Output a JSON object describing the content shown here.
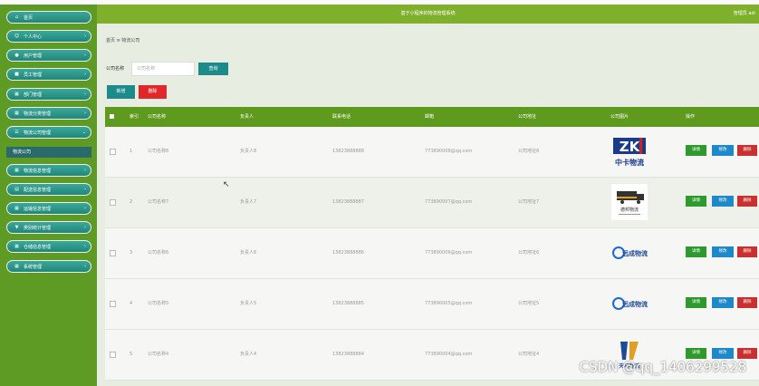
{
  "header": {
    "site_title": "基于小程序的物流管理系统",
    "user": "管理员 adi"
  },
  "sidebar": {
    "items": [
      {
        "label": "首页",
        "icon": "home-icon"
      },
      {
        "label": "个人中心",
        "icon": "person-icon"
      },
      {
        "label": "用户管理",
        "icon": "user-icon"
      },
      {
        "label": "员工管理",
        "icon": "staff-icon"
      },
      {
        "label": "部门管理",
        "icon": "grid-icon"
      },
      {
        "label": "物流分类管理",
        "icon": "grid-icon"
      },
      {
        "label": "物流公司管理",
        "icon": "list-icon"
      },
      {
        "label": "物流信息管理",
        "icon": "grid-icon"
      },
      {
        "label": "配送信息管理",
        "icon": "book-icon"
      },
      {
        "label": "运输信息管理",
        "icon": "grid-icon"
      },
      {
        "label": "类别统计管理",
        "icon": "chart-icon"
      },
      {
        "label": "仓储信息管理",
        "icon": "grid-icon"
      },
      {
        "label": "系统管理",
        "icon": "grid-icon"
      }
    ],
    "sub_item": "物流公司"
  },
  "breadcrumb": {
    "home": "首页",
    "sep": "≡",
    "current": "物流公司"
  },
  "search": {
    "label": "公司名称",
    "placeholder": "公司名称",
    "button": "查询"
  },
  "toolbar": {
    "add": "新增",
    "delete": "删除"
  },
  "table": {
    "headers": [
      "索引",
      "公司名称",
      "负责人",
      "联系电话",
      "邮箱",
      "公司地址",
      "公司图片",
      "操作"
    ],
    "rows": [
      {
        "index": "1",
        "name": "公司名称8",
        "manager": "负责人8",
        "phone": "13823888888",
        "email": "773890008@qq.com",
        "address": "公司地址8",
        "logo": "中卡物流"
      },
      {
        "index": "2",
        "name": "公司名称7",
        "manager": "负责人7",
        "phone": "13823888887",
        "email": "773890007@qq.com",
        "address": "公司地址7",
        "logo": "德邦物流"
      },
      {
        "index": "3",
        "name": "公司名称6",
        "manager": "负责人6",
        "phone": "13823888886",
        "email": "773890006@qq.com",
        "address": "公司地址6",
        "logo": "远成物流"
      },
      {
        "index": "4",
        "name": "公司名称5",
        "manager": "负责人5",
        "phone": "13823888885",
        "email": "773890005@qq.com",
        "address": "公司地址5",
        "logo": "远成物流"
      },
      {
        "index": "5",
        "name": "公司名称4",
        "manager": "负责人4",
        "phone": "13823888884",
        "email": "773890004@qq.com",
        "address": "公司地址4",
        "logo": "天马物流"
      }
    ],
    "actions": {
      "detail": "详情",
      "edit": "修改",
      "delete": "删除"
    }
  },
  "watermark": "CSDN @qq_1406299528",
  "colors": {
    "sidebar": "#5d9b24",
    "menu": "#22867a",
    "header": "#7fb02c",
    "table_head": "#5e9a1e",
    "danger": "#e0282a"
  }
}
